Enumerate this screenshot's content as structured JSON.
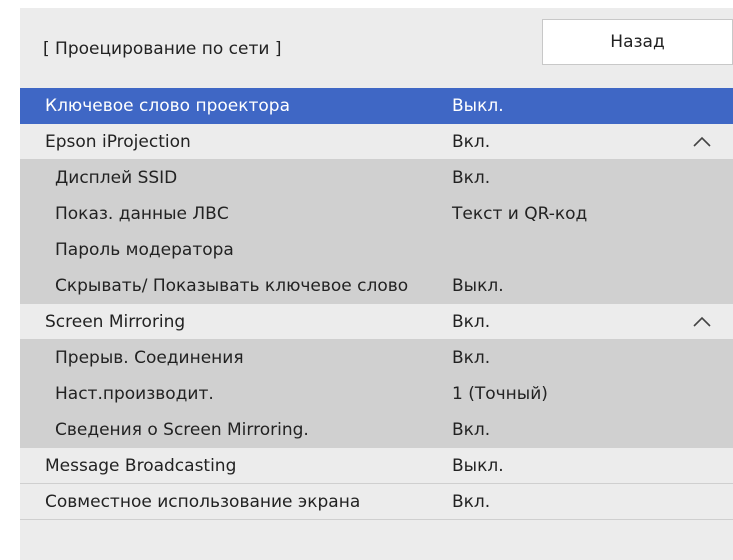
{
  "header": {
    "title": "[ Проецирование по сети ]",
    "back_label": "Назад"
  },
  "colors": {
    "selected_row": "#3f67c5",
    "panel_bg": "#ececec",
    "sub_row_bg": "#d0d0d0"
  },
  "rows": [
    {
      "label": "Ключевое слово проектора",
      "value": "Выкл."
    },
    {
      "label": "Epson iProjection",
      "value": "Вкл.",
      "icon": "chevron-up-icon"
    },
    {
      "label": "Дисплей SSID",
      "value": "Вкл."
    },
    {
      "label": "Показ. данные ЛВС",
      "value": "Текст и QR-код"
    },
    {
      "label": "Пароль модератора",
      "value": ""
    },
    {
      "label": "Скрывать/ Показывать ключевое слово",
      "value": "Выкл."
    },
    {
      "label": "Screen Mirroring",
      "value": "Вкл.",
      "icon": "chevron-up-icon"
    },
    {
      "label": "Прерыв. Соединения",
      "value": "Вкл."
    },
    {
      "label": "Наст.производит.",
      "value": "1 (Точный)"
    },
    {
      "label": "Сведения о Screen Mirroring.",
      "value": "Вкл."
    },
    {
      "label": "Message Broadcasting",
      "value": "Выкл."
    },
    {
      "label": "Совместное использование экрана",
      "value": "Вкл."
    }
  ]
}
